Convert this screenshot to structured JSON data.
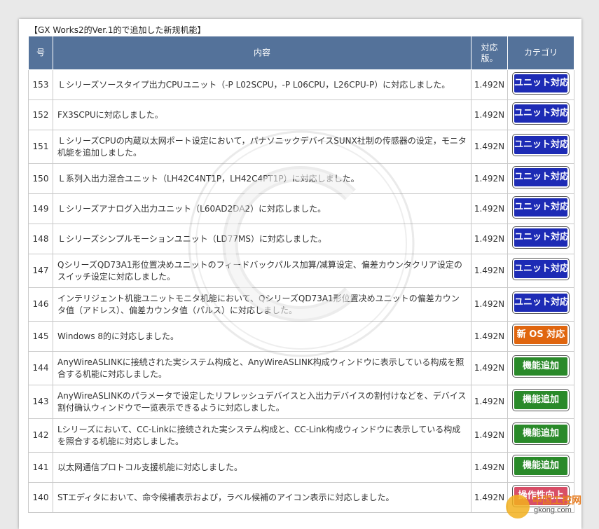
{
  "section_title": "【GX Works2的Ver.1的で追加した新规机能】",
  "table": {
    "headers": {
      "num": "号",
      "desc": "内容",
      "ver_line1": "対応",
      "ver_line2": "版。",
      "cat": "カテゴリ"
    },
    "rows": [
      {
        "num": "153",
        "desc": "Ｌシリーズソースタイプ出力CPUユニット（-P L02SCPU，-P L06CPU，L26CPU-P）に対応しました。",
        "ver": "1.492N",
        "cat": "ユニット対応",
        "kind": "unit"
      },
      {
        "num": "152",
        "desc": "FX3SCPUに対応しました。",
        "ver": "1.492N",
        "cat": "ユニット対応",
        "kind": "unit"
      },
      {
        "num": "151",
        "desc": "ＬシリーズCPUの内蔵以太网ポート设定において，パナソニックデバイスSUNX社制の传感器の设定，モニタ机能を追加しました。",
        "ver": "1.492N",
        "cat": "ユニット対応",
        "kind": "unit"
      },
      {
        "num": "150",
        "desc": "Ｌ系列入出力混合ユニット（LH42C4NT1P，LH42C4PT1P）に対応しました。",
        "ver": "1.492N",
        "cat": "ユニット対応",
        "kind": "unit"
      },
      {
        "num": "149",
        "desc": "Ｌシリーズアナログ入出力ユニット（L60AD2DA2）に対応しました。",
        "ver": "1.492N",
        "cat": "ユニット対応",
        "kind": "unit"
      },
      {
        "num": "148",
        "desc": "Ｌシリーズシンプルモーションユニット（LD77MS）に対応しました。",
        "ver": "1.492N",
        "cat": "ユニット対応",
        "kind": "unit"
      },
      {
        "num": "147",
        "desc": "QシリーズQD73A1形位置决めユニットのフィードバックパルス加算/减算设定、偏差カウンタクリア设定のスイッチ设定に対応しました。",
        "ver": "1.492N",
        "cat": "ユニット対応",
        "kind": "unit"
      },
      {
        "num": "146",
        "desc": "インテリジェント机能ユニットモニタ机能において、QシリーズQD73A1形位置决めユニットの偏差カウンタ值（アドレス）、偏差カウンタ值（パルス）に対応しました。",
        "ver": "1.492N",
        "cat": "ユニット対応",
        "kind": "unit"
      },
      {
        "num": "145",
        "desc": "Windows 8的に対応しました。",
        "ver": "1.492N",
        "cat": "新 OS 対応",
        "kind": "os"
      },
      {
        "num": "144",
        "desc": "AnyWireASLINKに接続された実システム构成と、AnyWireASLINK构成ウィンドウに表示している构成を照合する机能に対応しました。",
        "ver": "1.492N",
        "cat": "機能追加",
        "kind": "feature"
      },
      {
        "num": "143",
        "desc": "AnyWireASLINKのパラメータで设定したリフレッシュデバイスと入出力デバイスの割付けなどを、デバイス割付确认ウィンドウで一览表示できるように対応しました。",
        "ver": "1.492N",
        "cat": "機能追加",
        "kind": "feature"
      },
      {
        "num": "142",
        "desc": "Lシリーズにおいて、CC-Linkに接続された実システム构成と、CC-Link构成ウィンドウに表示している构成を照合する机能に対応しました。",
        "ver": "1.492N",
        "cat": "機能追加",
        "kind": "feature"
      },
      {
        "num": "141",
        "desc": "以太网通信プロトコル支援机能に対応しました。",
        "ver": "1.492N",
        "cat": "機能追加",
        "kind": "feature"
      },
      {
        "num": "140",
        "desc": "STエディタにおいて、命令候補表示および，ラベル候補のアイコン表示に対応しました。",
        "ver": "1.492N",
        "cat": "操作性向上",
        "kind": "ops"
      }
    ]
  },
  "logo": {
    "text": "中国工控网",
    "url": "gkong.com"
  }
}
